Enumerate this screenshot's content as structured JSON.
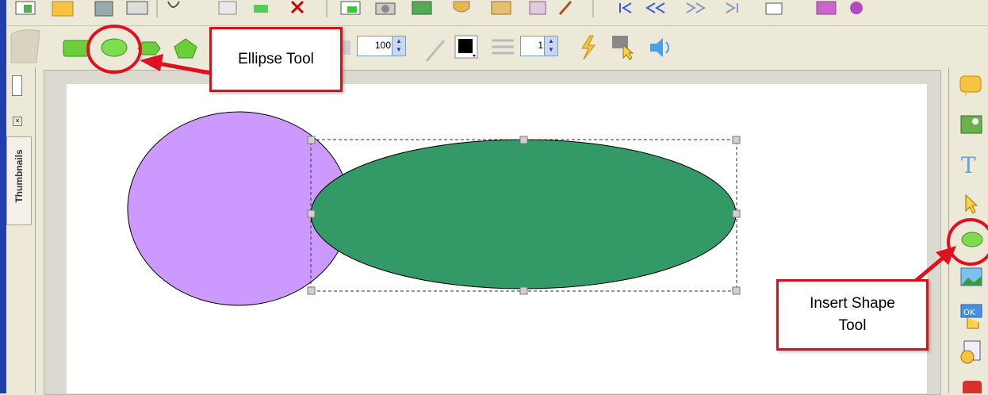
{
  "annotations": {
    "ellipse_tool_label": "Ellipse Tool",
    "insert_shape_tool_label": "Insert Shape Tool"
  },
  "toolbar": {
    "opacity_value": "100",
    "line_width_value": "1"
  },
  "thumbnails_panel": {
    "tab_label": "Thumbnails"
  },
  "shapes": {
    "circle_fill": "#cc99ff",
    "ellipse_fill": "#339966"
  },
  "colors": {
    "callout_border": "#d9101a",
    "selection_handle": "#c0c0c0"
  }
}
